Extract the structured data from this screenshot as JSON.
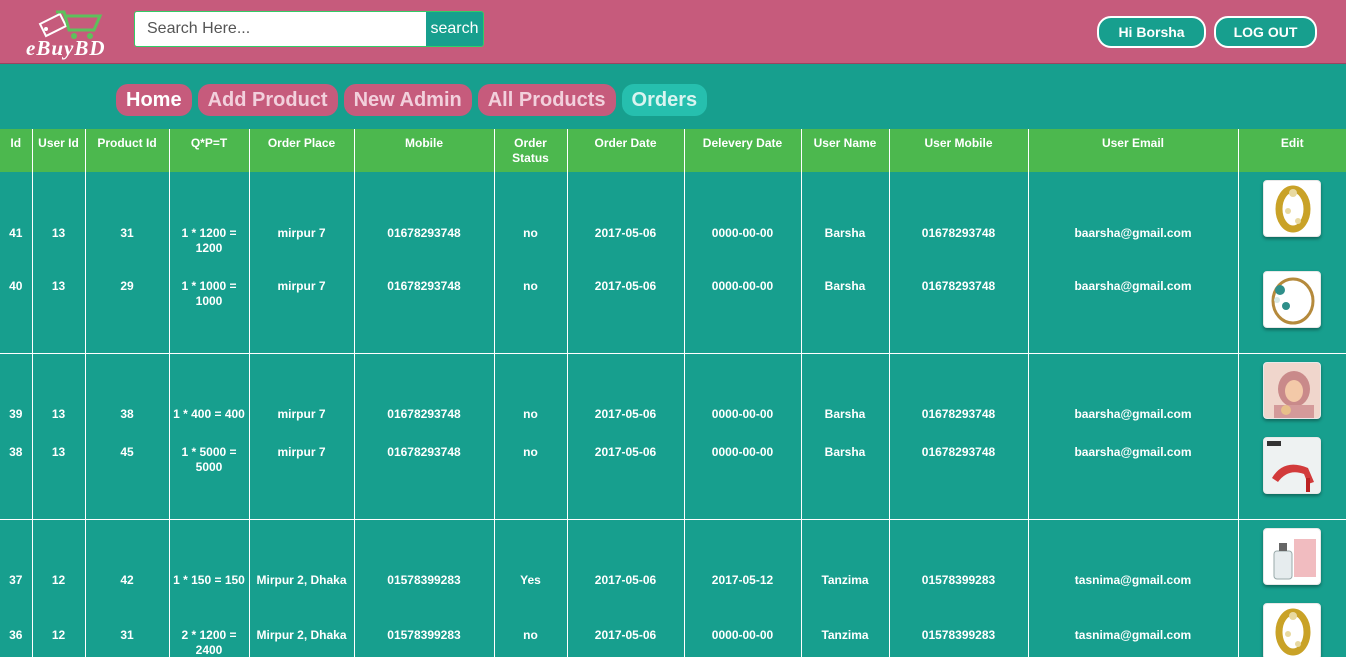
{
  "brand": {
    "name": "eBuyBD"
  },
  "search": {
    "placeholder": "Search Here...",
    "value": "",
    "button": "search"
  },
  "user": {
    "greeting": "Hi Borsha",
    "logout": "LOG OUT"
  },
  "nav": {
    "items": [
      {
        "label": "Home"
      },
      {
        "label": "Add Product"
      },
      {
        "label": "New Admin"
      },
      {
        "label": "All Products"
      },
      {
        "label": "Orders"
      }
    ],
    "active": "Orders"
  },
  "table": {
    "headers": [
      "Id",
      "User Id",
      "Product Id",
      "Q*P=T",
      "Order Place",
      "Mobile",
      "Order Status",
      "Order Date",
      "Delevery Date",
      "User Name",
      "User Mobile",
      "User Email",
      "Edit"
    ],
    "rows": [
      {
        "id": "41",
        "user_id": "13",
        "product_id": "31",
        "qpt": "1 * 1200 = 1200",
        "place": "mirpur 7",
        "mobile": "01678293748",
        "status": "no",
        "order_date": "2017-05-06",
        "delivery_date": "0000-00-00",
        "user_name": "Barsha",
        "user_mobile": "01678293748",
        "user_email": "baarsha@gmail.com",
        "image": "gold-ring"
      },
      {
        "id": "40",
        "user_id": "13",
        "product_id": "29",
        "qpt": "1 * 1000 = 1000",
        "place": "mirpur 7",
        "mobile": "01678293748",
        "status": "no",
        "order_date": "2017-05-06",
        "delivery_date": "0000-00-00",
        "user_name": "Barsha",
        "user_mobile": "01678293748",
        "user_email": "baarsha@gmail.com",
        "image": "jeweled-bracelet"
      },
      {
        "id": "39",
        "user_id": "13",
        "product_id": "38",
        "qpt": "1 * 400 = 400",
        "place": "mirpur 7",
        "mobile": "01678293748",
        "status": "no",
        "order_date": "2017-05-06",
        "delivery_date": "0000-00-00",
        "user_name": "Barsha",
        "user_mobile": "01678293748",
        "user_email": "baarsha@gmail.com",
        "image": "hijab-model"
      },
      {
        "id": "38",
        "user_id": "13",
        "product_id": "45",
        "qpt": "1 * 5000 = 5000",
        "place": "mirpur 7",
        "mobile": "01678293748",
        "status": "no",
        "order_date": "2017-05-06",
        "delivery_date": "0000-00-00",
        "user_name": "Barsha",
        "user_mobile": "01678293748",
        "user_email": "baarsha@gmail.com",
        "image": "red-sandal"
      },
      {
        "id": "37",
        "user_id": "12",
        "product_id": "42",
        "qpt": "1 * 150 = 150",
        "place": "Mirpur 2, Dhaka",
        "mobile": "01578399283",
        "status": "Yes",
        "order_date": "2017-05-06",
        "delivery_date": "2017-05-12",
        "user_name": "Tanzima",
        "user_mobile": "01578399283",
        "user_email": "tasnima@gmail.com",
        "image": "perfume-bottle"
      },
      {
        "id": "36",
        "user_id": "12",
        "product_id": "31",
        "qpt": "2 * 1200 = 2400",
        "place": "Mirpur 2, Dhaka",
        "mobile": "01578399283",
        "status": "no",
        "order_date": "2017-05-06",
        "delivery_date": "0000-00-00",
        "user_name": "Tanzima",
        "user_mobile": "01578399283",
        "user_email": "tasnima@gmail.com",
        "image": "gold-ring"
      }
    ]
  },
  "colors": {
    "header": "#c65b7c",
    "page": "#179f8e",
    "table_header": "#4cb84e",
    "nav_active": "#26bfae"
  }
}
